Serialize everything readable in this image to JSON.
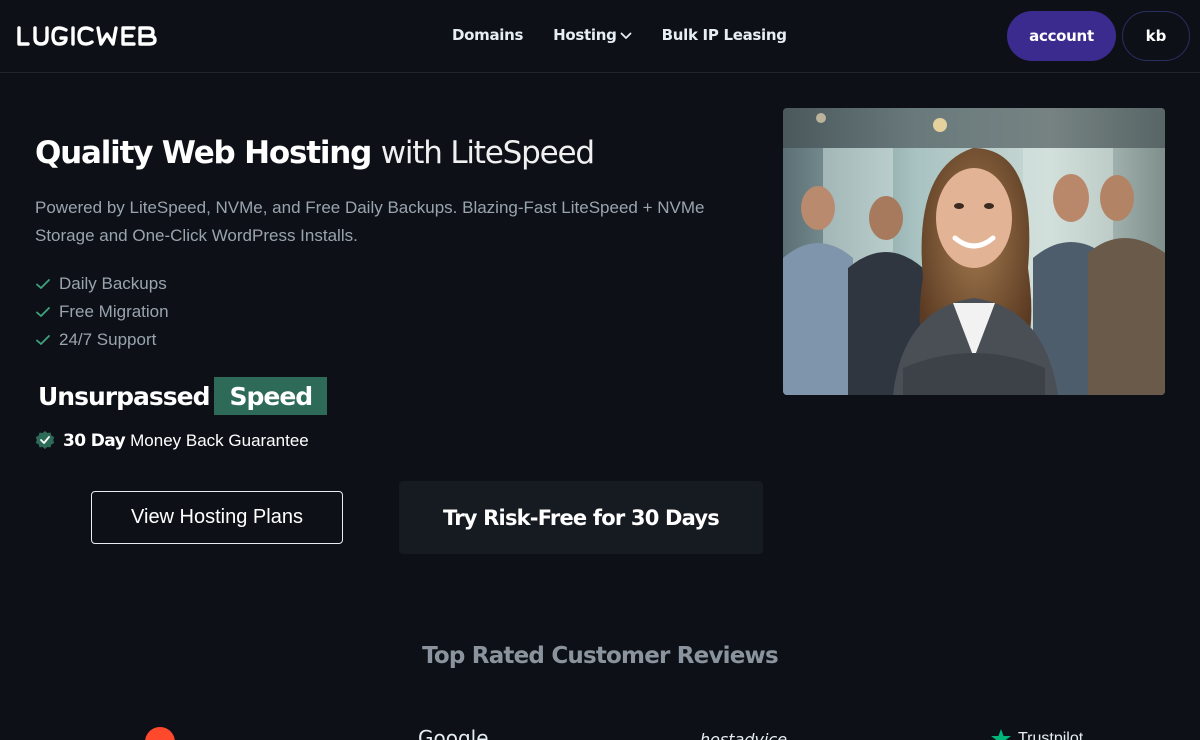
{
  "brand": {
    "name": "LOGICWEB"
  },
  "nav": {
    "items": [
      {
        "label": "Domains"
      },
      {
        "label": "Hosting"
      },
      {
        "label": "Bulk IP Leasing"
      }
    ],
    "account_label": "account",
    "profile_initials": "kb"
  },
  "hero": {
    "title_strong": "Quality Web Hosting",
    "title_light": "with LiteSpeed",
    "description": "Powered by LiteSpeed, NVMe, and Free Daily Backups. Blazing-Fast LiteSpeed + NVMe Storage and One-Click WordPress Installs.",
    "features": [
      "Daily Backups",
      "Free Migration",
      "24/7 Support"
    ],
    "speed_word": "Unsurpassed",
    "speed_badge": "Speed",
    "guarantee_bold": "30 Day",
    "guarantee_rest": "Money Back Guarantee",
    "primary_button": "View Hosting Plans",
    "secondary_button": "Try Risk-Free for 30 Days"
  },
  "reviews": {
    "title_strong": "Top Rated",
    "title_light": "Customer Reviews",
    "logos": [
      "Google",
      "hostadvice",
      "Trustpilot"
    ]
  },
  "colors": {
    "background": "#0d1117",
    "accent_purple": "#3b2b8f",
    "accent_green": "#2d6a58",
    "check_green": "#3fa37f"
  }
}
